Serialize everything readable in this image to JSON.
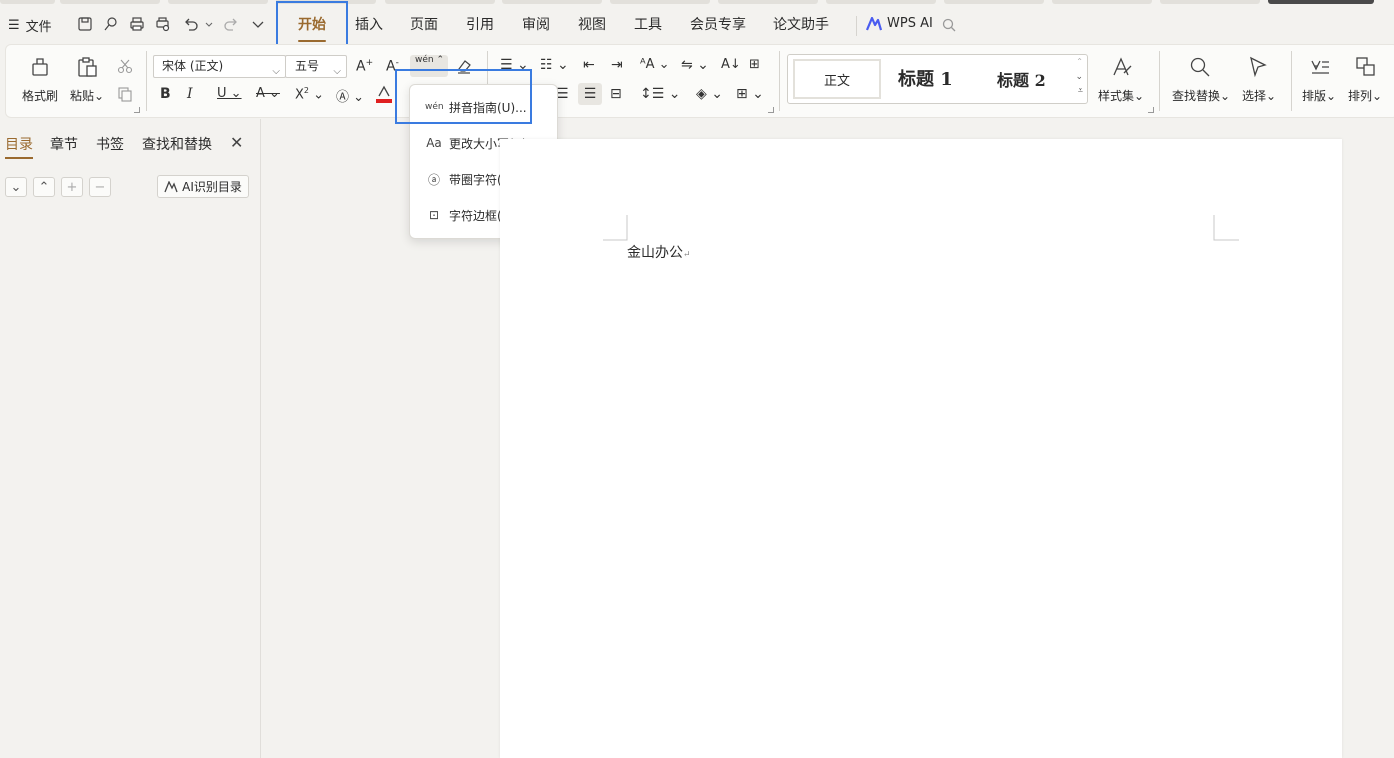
{
  "menu": {
    "file_label": "文件",
    "tabs": [
      "开始",
      "插入",
      "页面",
      "引用",
      "审阅",
      "视图",
      "工具",
      "会员专享",
      "论文助手"
    ],
    "active_tab": "开始",
    "wps_ai_label": "WPS AI"
  },
  "ribbon": {
    "format_painter": "格式刷",
    "paste": "粘贴",
    "font_name": "宋体 (正文)",
    "font_size": "五号",
    "phonetic_icon": "wén",
    "styles": {
      "normal": "正文",
      "heading1": "标题 1",
      "heading2": "标题 2"
    },
    "style_set": "样式集",
    "find_replace": "查找替换",
    "select": "选择",
    "layout": "排版",
    "arrange": "排列"
  },
  "dropdown": {
    "items": [
      {
        "label": "拼音指南(U)...",
        "icon": "phonetic-guide-icon"
      },
      {
        "label": "更改大小写(C)...",
        "icon": "change-case-icon"
      },
      {
        "label": "带圈字符(E)...",
        "icon": "enclosed-char-icon"
      },
      {
        "label": "字符边框(B)",
        "icon": "char-border-icon"
      }
    ]
  },
  "left_pane": {
    "tabs": [
      "目录",
      "章节",
      "书签",
      "查找和替换"
    ],
    "active_tab": "目录",
    "ai_toc_label": "AI识别目录"
  },
  "document": {
    "text": "金山办公"
  },
  "colors": {
    "accent": "#9a6a2f",
    "highlight": "#3a7be0",
    "font_color_bar": "#e02020"
  }
}
